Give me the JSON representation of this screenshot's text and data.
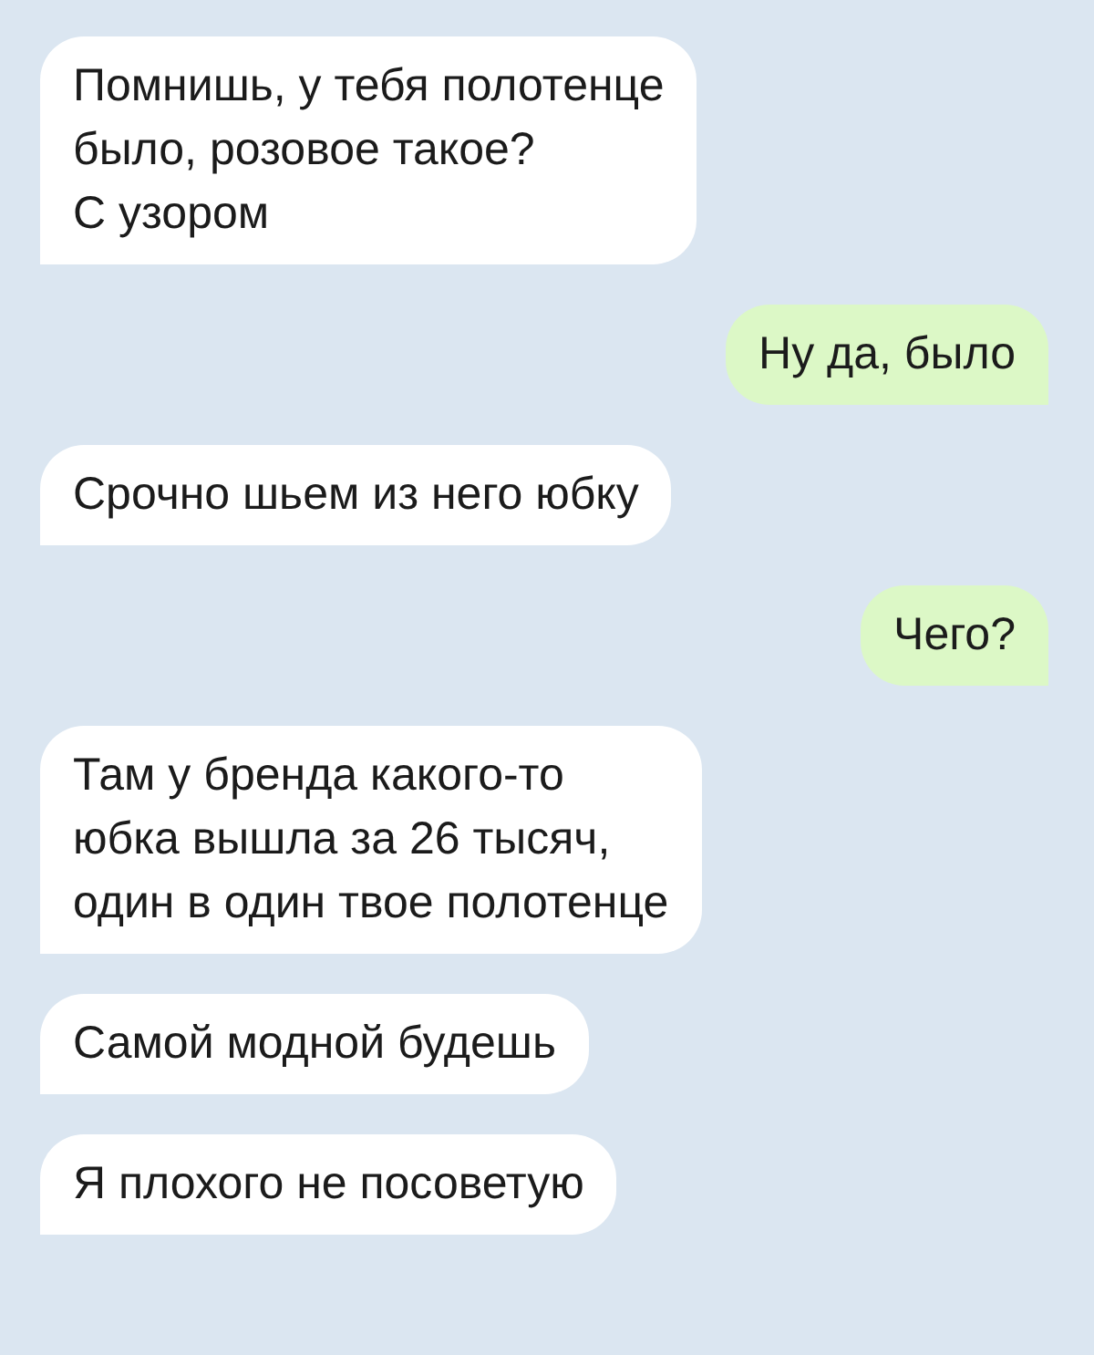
{
  "messages": [
    {
      "kind": "incoming",
      "text": "Помнишь, у тебя полотенце\nбыло, розовое такое?\nС узором"
    },
    {
      "kind": "outgoing",
      "text": "Ну да, было"
    },
    {
      "kind": "incoming",
      "text": "Срочно шьем из него юбку"
    },
    {
      "kind": "outgoing",
      "text": "Чего?"
    },
    {
      "kind": "incoming",
      "text": "Там у бренда какого-то\nюбка вышла за 26 тысяч,\nодин в один твое полотенце"
    },
    {
      "kind": "incoming",
      "text": "Самой модной будешь"
    },
    {
      "kind": "incoming",
      "text": "Я плохого не посоветую"
    }
  ]
}
